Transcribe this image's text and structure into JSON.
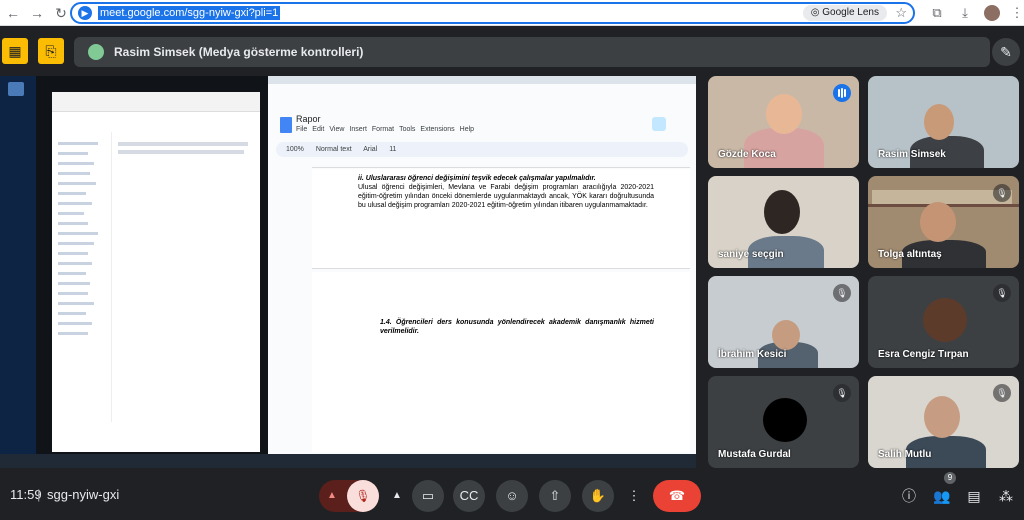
{
  "browser": {
    "url": "meet.google.com/sgg-nyiw-gxi?pli=1",
    "lens_label": "Google Lens"
  },
  "presentation": {
    "title": "Rasim Simsek (Medya gösterme kontrolleri)"
  },
  "shared_doc": {
    "doc_title": "Rapor",
    "menu": [
      "File",
      "Edit",
      "View",
      "Insert",
      "Format",
      "Tools",
      "Extensions",
      "Help"
    ],
    "zoom": "100%",
    "style": "Normal text",
    "font": "Arial",
    "font_size": "11",
    "heading1": "ii. Uluslararası öğrenci değişimini teşvik edecek çalışmalar yapılmalıdır.",
    "paragraph": "Ulusal öğrenci değişimleri, Mevlana ve Farabi değişim programları aracılığıyla 2020-2021 eğitim-öğretim yılından önceki dönemlerde uygulanmaktaydı ancak, YÖK kararı doğrultusunda bu ulusal değişim programları 2020-2021 eğitim-öğretim yılından itibaren uygulanmamaktadır.",
    "heading2": "1.4. Öğrencileri ders konusunda yönlendirecek akademik danışmanlık hizmeti verilmelidir."
  },
  "participants": [
    {
      "name": "Gözde Koca"
    },
    {
      "name": "Rasim Simsek"
    },
    {
      "name": "saniye seçgin"
    },
    {
      "name": "Tolga altıntaş"
    },
    {
      "name": "İbrahim Kesici"
    },
    {
      "name": "Esra Cengiz Tırpan"
    },
    {
      "name": "Mustafa Gurdal"
    },
    {
      "name": "Salih Mutlu"
    }
  ],
  "bottom_bar": {
    "time": "11:59",
    "separator": "|",
    "meeting_code": "sgg-nyiw-gxi",
    "participant_count": "9"
  },
  "colors": {
    "background": "#202124",
    "tile": "#3c4043",
    "end_call": "#ea4335",
    "accent": "#1a73e8",
    "yellow": "#fbbc04"
  }
}
